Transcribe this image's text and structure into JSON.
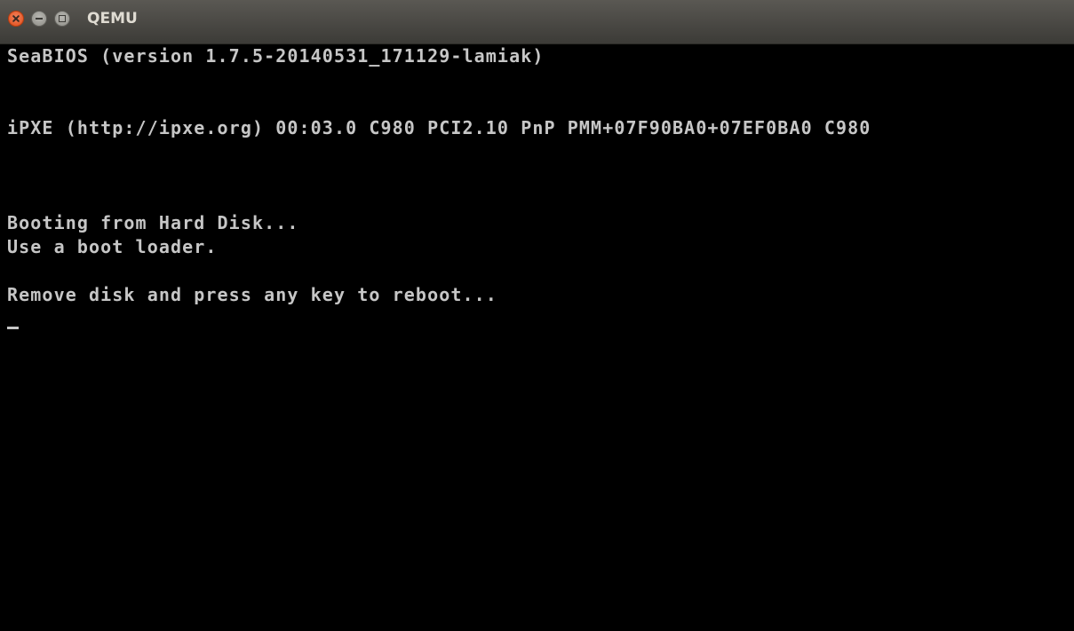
{
  "window": {
    "title": "QEMU"
  },
  "console": {
    "lines": [
      "SeaBIOS (version 1.7.5-20140531_171129-lamiak)",
      "iPXE (http://ipxe.org) 00:03.0 C980 PCI2.10 PnP PMM+07F90BA0+07EF0BA0 C980",
      "Booting from Hard Disk...",
      "Use a boot loader.",
      "Remove disk and press any key to reboot..."
    ],
    "foreground": "#c6c6c6",
    "background": "#000000"
  }
}
